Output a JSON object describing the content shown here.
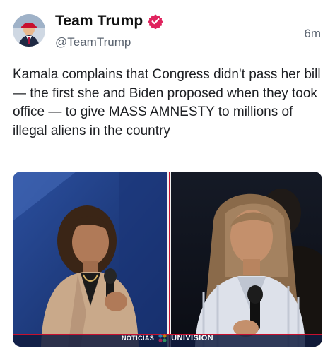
{
  "post": {
    "display_name": "Team Trump",
    "handle": "@TeamTrump",
    "timestamp": "6m",
    "text": "Kamala complains that Congress didn't pass her bill — the first she and Biden proposed when they took office — to give MASS AMNESTY to millions of illegal aliens in the country",
    "verified": true,
    "verified_color": "#e0245e",
    "avatar_icon": "avatar-photo"
  },
  "media": {
    "watermark_left": "NOTICIAS",
    "watermark_brand": "UNIVISION"
  }
}
